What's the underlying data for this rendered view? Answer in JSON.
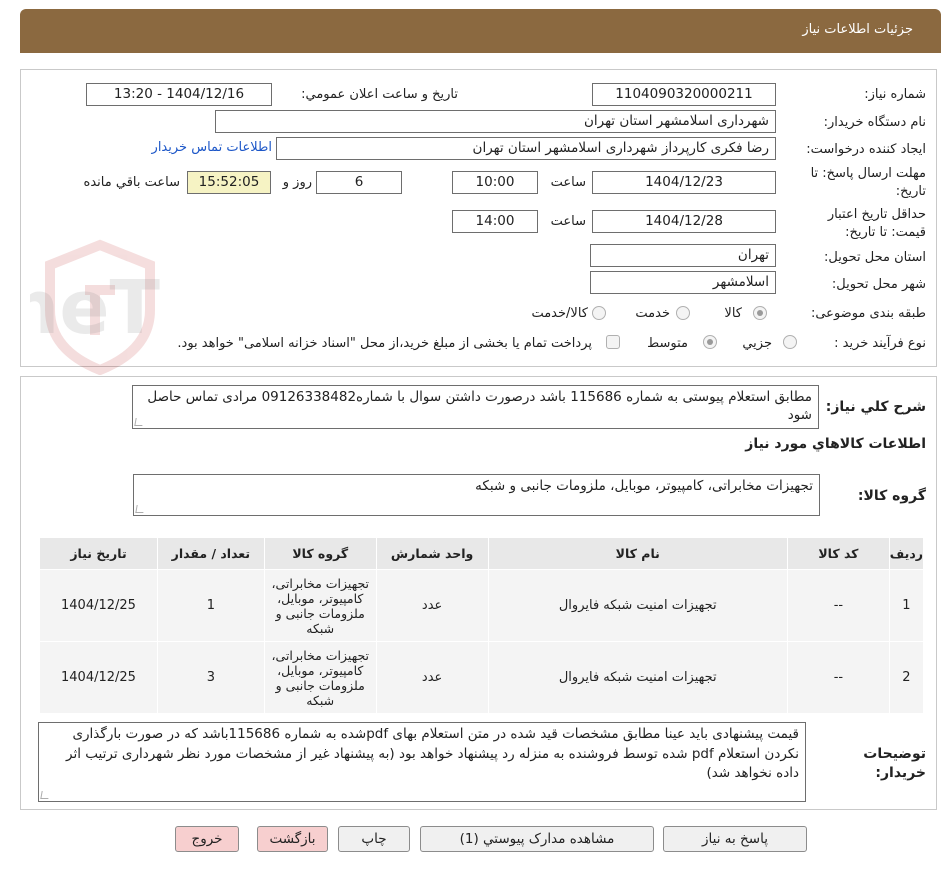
{
  "header": {
    "title": "جزئیات اطلاعات نیاز"
  },
  "form": {
    "need_number_label": "شماره نیاز:",
    "need_number": "1104090320000211",
    "announce_label": "تاریخ و ساعت اعلان عمومي:",
    "announce_value": "1404/12/16 - 13:20",
    "buyer_org_label": "نام دستگاه خریدار:",
    "buyer_org": "شهرداری اسلامشهر استان تهران",
    "creator_label": "ایجاد کننده درخواست:",
    "creator": "رضا فکری کارپرداز شهرداری اسلامشهر استان تهران",
    "contact_link": "اطلاعات تماس خریدار",
    "deadline_label_1": "مهلت ارسال پاسخ: تا",
    "deadline_label_2": "تاریخ:",
    "deadline_date": "1404/12/23",
    "time_label": "ساعت",
    "deadline_time": "10:00",
    "days": "6",
    "days_label": "روز و",
    "remaining_time": "15:52:05",
    "remaining_label": "ساعت باقي مانده",
    "validity_label_1": "حداقل تاریخ اعتبار",
    "validity_label_2": "قیمت: تا تاریخ:",
    "validity_date": "1404/12/28",
    "validity_time": "14:00",
    "province_label": "استان محل تحویل:",
    "province": "تهران",
    "city_label": "شهر محل تحویل:",
    "city": "اسلامشهر",
    "category_label": "طبقه بندی موضوعی:",
    "category_options": [
      "کالا",
      "خدمت",
      "کالا/خدمت"
    ],
    "process_label": "نوع فرآیند خرید :",
    "process_options": [
      "جزیي",
      "متوسط"
    ],
    "payment_note": "پرداخت تمام یا بخشی از مبلغ خرید،از محل \"اسناد خزانه اسلامی\" خواهد بود."
  },
  "details": {
    "summary_label": "شرح کلي نیاز:",
    "summary": "مطابق  استعلام پیوستی به شماره 115686 باشد درصورت داشتن سوال با شماره09126338482 مرادی تماس حاصل شود",
    "goods_info_title": "اطلاعات کالاهاي مورد نیاز",
    "goods_group_label": "گروه کالا:",
    "goods_group": "تجهیزات مخابراتی، کامپیوتر، موبایل، ملزومات جانبی و شبکه",
    "buyer_notes_label_1": "توضیحات",
    "buyer_notes_label_2": "خریدار:",
    "buyer_notes": "قیمت پیشنهادی باید عینا مطابق مشخصات قید شده در متن استعلام بهای pdfشده به شماره   115686باشد که  در صورت بارگذاری نکردن استعلام pdf شده توسط فروشنده به منزله رد پیشنهاد خواهد بود (به پیشنهاد غیر از مشخصات مورد نظر شهرداری ترتیب اثر داده نخواهد  شد)"
  },
  "table": {
    "headers": [
      "ردیف",
      "کد کالا",
      "نام کالا",
      "واحد شمارش",
      "گروه کالا",
      "تعداد / مقدار",
      "تاریخ نیاز"
    ],
    "rows": [
      {
        "idx": "1",
        "code": "--",
        "name": "تجهیزات امنیت شبکه فایروال",
        "unit": "عدد",
        "group": "تجهیزات مخابراتی، کامپیوتر، موبایل، ملزومات جانبی و شبکه",
        "qty": "1",
        "date": "1404/12/25"
      },
      {
        "idx": "2",
        "code": "--",
        "name": "تجهیزات امنیت شبکه فایروال",
        "unit": "عدد",
        "group": "تجهیزات مخابراتی، کامپیوتر، موبایل، ملزومات جانبی و شبکه",
        "qty": "3",
        "date": "1404/12/25"
      }
    ]
  },
  "buttons": {
    "reply": "پاسخ به نیاز",
    "attachments": "مشاهده مدارک پیوستي (1)",
    "print": "چاپ",
    "back": "بازگشت",
    "exit": "خروج"
  },
  "watermark": {
    "text": "AriaTender.neT"
  }
}
